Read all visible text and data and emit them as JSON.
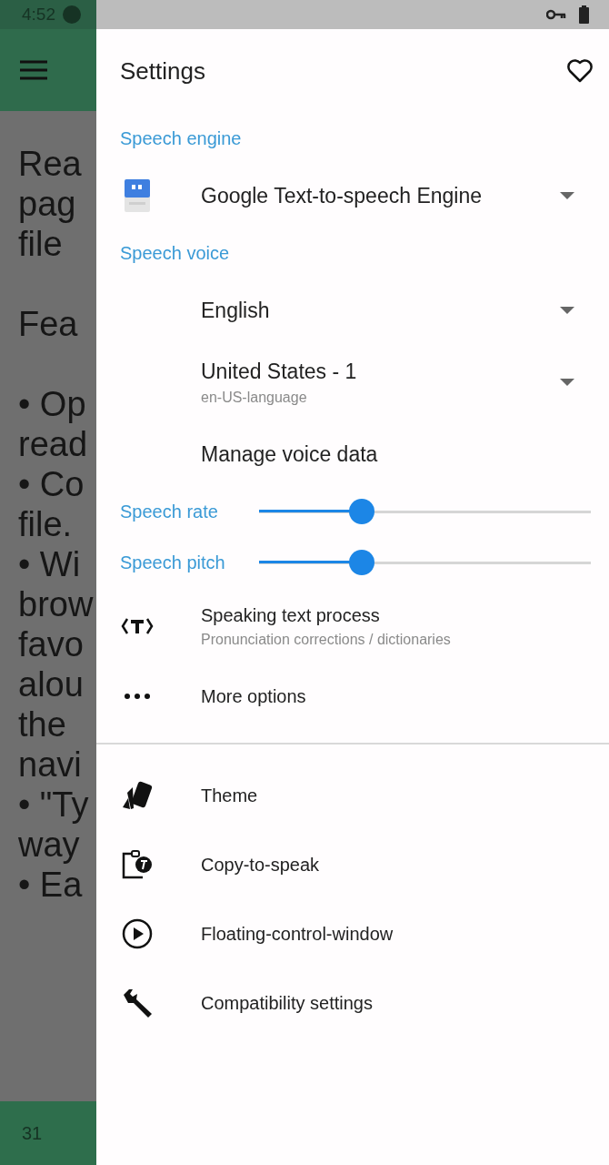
{
  "status_bar": {
    "time": "4:52"
  },
  "background": {
    "paragraphs": [
      [
        "Rea",
        "pag",
        "file"
      ],
      [
        "Fea"
      ],
      [
        "• Op",
        "read",
        "• Co",
        "file.",
        "• Wi",
        "brow",
        "favo",
        "alou",
        "the",
        "navi",
        "• \"Ty",
        "way",
        "• Ea"
      ]
    ],
    "page_number": "31"
  },
  "drawer": {
    "title": "Settings",
    "items": [
      {
        "kind": "header",
        "label": "Speech engine"
      },
      {
        "kind": "select",
        "value": "Google Text-to-speech Engine"
      },
      {
        "kind": "header",
        "label": "Speech voice"
      },
      {
        "kind": "select",
        "value": "English"
      },
      {
        "kind": "select",
        "value": "United States - 1",
        "subtitle": "en-US-language"
      },
      {
        "kind": "action",
        "label": "Manage voice data"
      },
      {
        "kind": "slider",
        "label": "Speech rate",
        "level": 0.31
      },
      {
        "kind": "slider",
        "label": "Speech pitch",
        "level": 0.31
      },
      {
        "kind": "action",
        "label": "Speaking text process",
        "subtitle": "Pronunciation corrections / dictionaries"
      },
      {
        "kind": "action",
        "label": "More options"
      },
      {
        "kind": "divider"
      },
      {
        "kind": "action",
        "label": "Theme"
      },
      {
        "kind": "action",
        "label": "Copy-to-speak"
      },
      {
        "kind": "action",
        "label": "Floating-control-window"
      },
      {
        "kind": "action",
        "label": "Compatibility settings"
      }
    ]
  }
}
